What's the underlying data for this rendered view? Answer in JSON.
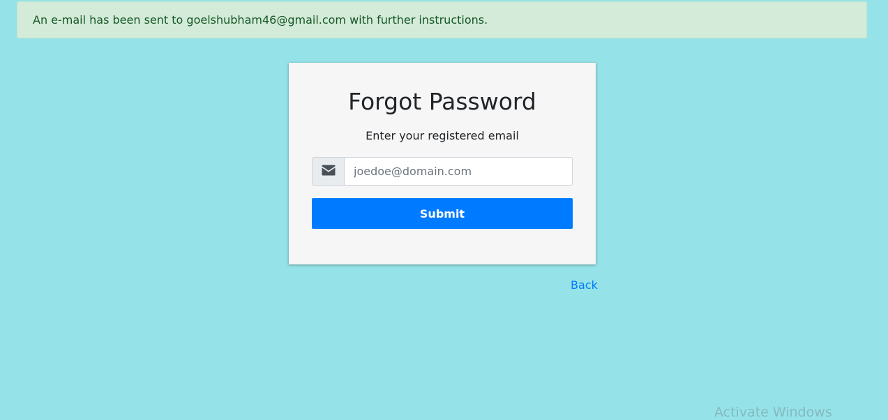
{
  "alert": {
    "message": "An e-mail has been sent to goelshubham46@gmail.com with further instructions.",
    "background_color": "#d4ebd9",
    "text_color": "#155724"
  },
  "card": {
    "title": "Forgot Password",
    "subtitle": "Enter your registered email",
    "email_input": {
      "icon": "envelope-icon",
      "value": "",
      "placeholder": "joedoe@domain.com"
    },
    "submit_label": "Submit"
  },
  "back_link": {
    "label": "Back"
  },
  "watermark": {
    "text": "Activate Windows"
  },
  "colors": {
    "page_background": "#95e3e8",
    "card_background": "#f6f6f6",
    "primary": "#007bff"
  }
}
